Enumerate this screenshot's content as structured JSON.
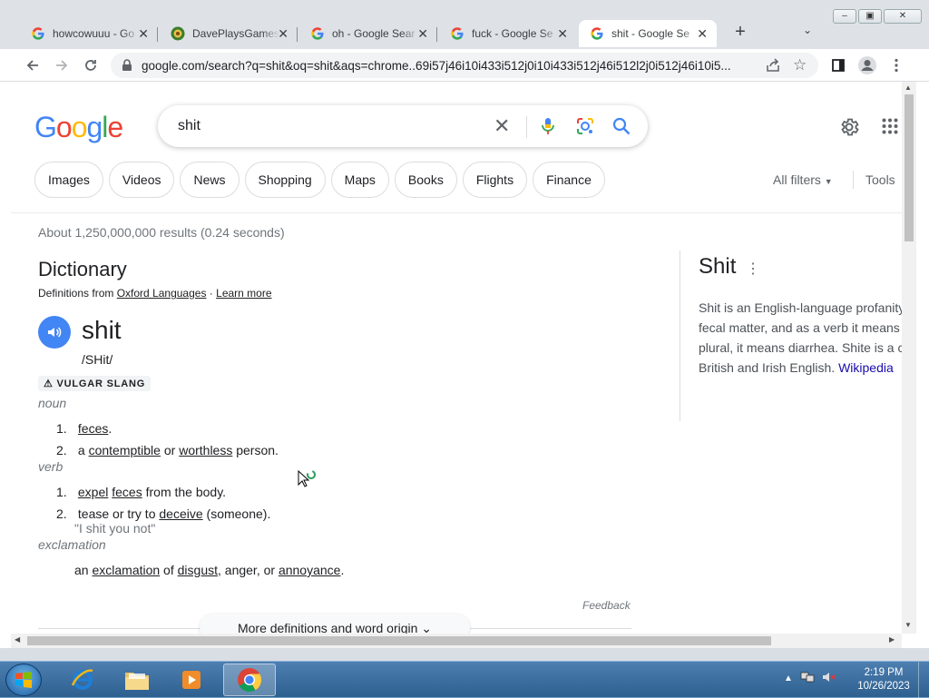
{
  "browser": {
    "tabs": [
      {
        "title": "howcowuuu - Go",
        "favicon": "google-g-icon"
      },
      {
        "title": "DavePlaysGames",
        "favicon": "channel-avatar-icon"
      },
      {
        "title": "oh - Google Sear",
        "favicon": "google-g-icon"
      },
      {
        "title": "fuck - Google Se",
        "favicon": "google-g-icon"
      },
      {
        "title": "shit - Google Se",
        "favicon": "google-g-icon",
        "active": true
      }
    ],
    "new_tab": "+",
    "url": "google.com/search?q=shit&oq=shit&aqs=chrome..69i57j46i10i433i512j0i10i433i512j46i512l2j0i512j46i10i5..."
  },
  "google": {
    "logo": "Google",
    "query": "shit",
    "chips": [
      "Images",
      "Videos",
      "News",
      "Shopping",
      "Maps",
      "Books",
      "Flights",
      "Finance"
    ],
    "all_filters": "All filters",
    "tools": "Tools",
    "stats": "About 1,250,000,000 results (0.24 seconds)"
  },
  "dictionary": {
    "title": "Dictionary",
    "from_prefix": "Definitions from",
    "source": "Oxford Languages",
    "learn_more": "Learn more",
    "word": "shit",
    "phonetic": "/SHit/",
    "badge": "VULGAR SLANG",
    "noun_label": "noun",
    "noun_defs": [
      {
        "num": "1.",
        "words": [
          "feces",
          "."
        ]
      },
      {
        "num": "2.",
        "words": [
          "a ",
          "contemptible",
          " or ",
          "worthless",
          " person."
        ]
      }
    ],
    "verb_label": "verb",
    "verb_defs": [
      {
        "num": "1.",
        "words": [
          "expel",
          " ",
          "feces",
          " from the body."
        ]
      },
      {
        "num": "2.",
        "words": [
          "tease or try to ",
          "deceive",
          " (someone)."
        ],
        "example": "\"I shit you not\""
      }
    ],
    "excl_label": "exclamation",
    "excl_def": [
      "an ",
      "exclamation",
      " of ",
      "disgust",
      ", anger, or ",
      "annoyance",
      "."
    ],
    "feedback": "Feedback",
    "more_label": "More definitions and word origin"
  },
  "knowledge_panel": {
    "title": "Shit",
    "lines": [
      "Shit is an English-language profanity",
      "fecal matter, and as a verb it means",
      "plural, it means diarrhea. Shite is a c",
      "British and Irish English."
    ],
    "link": "Wikipedia"
  },
  "taskbar": {
    "time": "2:19 PM",
    "date": "10/26/2023"
  }
}
